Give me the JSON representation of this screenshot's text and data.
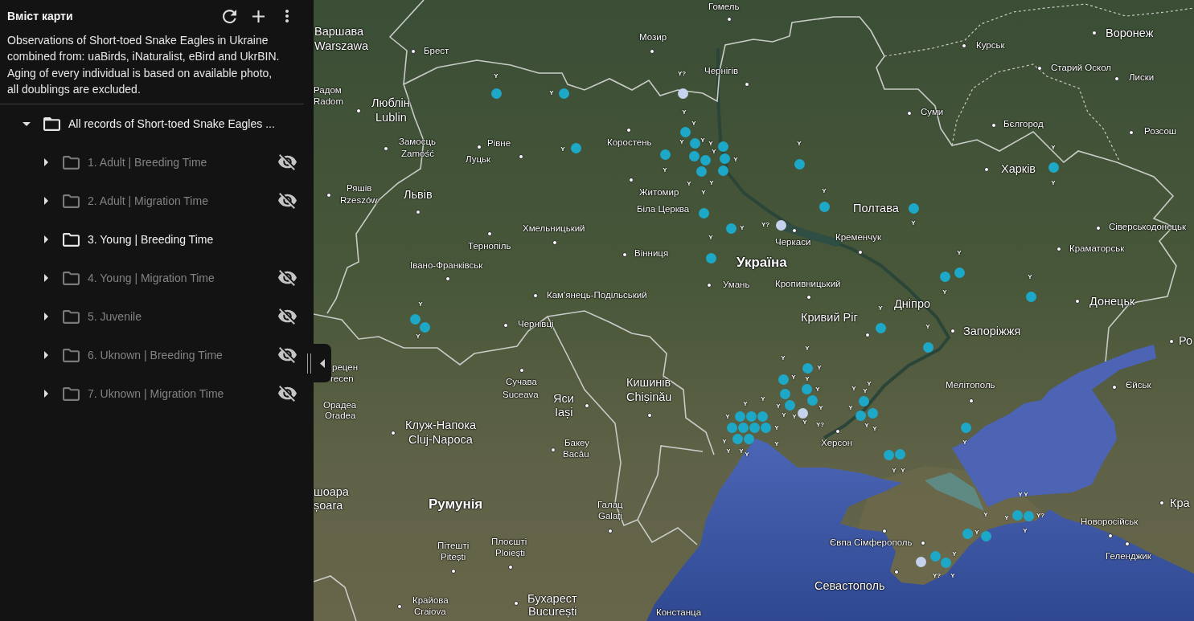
{
  "sidebar": {
    "title": "Вміст карти",
    "description": "Observations of Short-toed Snake Eagles in Ukraine combined from: uaBirds, iNaturalist, eBird and UkrBIN. Aging of every individual is based on available photo, all doublings are excluded.",
    "tree": {
      "label": "All records of Short-toed Snake Eagles ...",
      "expanded": true,
      "visible": true,
      "children": [
        {
          "label": "1. Adult | Breeding Time",
          "expanded": false,
          "visible": false
        },
        {
          "label": "2. Adult | Migration Time",
          "expanded": false,
          "visible": false
        },
        {
          "label": "3. Young | Breeding Time",
          "expanded": false,
          "visible": true
        },
        {
          "label": "4. Young | Migration Time",
          "expanded": false,
          "visible": false
        },
        {
          "label": "5. Juvenile",
          "expanded": false,
          "visible": false
        },
        {
          "label": "6. Uknown | Breeding Time",
          "expanded": false,
          "visible": false
        },
        {
          "label": "7. Uknown | Migration Time",
          "expanded": false,
          "visible": false
        }
      ]
    }
  },
  "map": {
    "place_labels": [
      {
        "text": "Гомель",
        "kind": "minor"
      },
      {
        "text": "Варшава",
        "kind": "major"
      },
      {
        "text": "Warszawa",
        "kind": "major"
      },
      {
        "text": "Мозир",
        "kind": "minor"
      },
      {
        "text": "Воронеж",
        "kind": "major"
      },
      {
        "text": "Брест",
        "kind": "minor"
      },
      {
        "text": "Курськ",
        "kind": "minor"
      },
      {
        "text": "Чернігів",
        "kind": "minor"
      },
      {
        "text": "Старий Оскол",
        "kind": "minor"
      },
      {
        "text": "Лиски",
        "kind": "minor"
      },
      {
        "text": "Радом",
        "kind": "minor"
      },
      {
        "text": "Radom",
        "kind": "minor"
      },
      {
        "text": "Люблін",
        "kind": "major"
      },
      {
        "text": "Lublin",
        "kind": "major"
      },
      {
        "text": "Суми",
        "kind": "minor"
      },
      {
        "text": "Бєлгород",
        "kind": "minor"
      },
      {
        "text": "Розсош",
        "kind": "minor"
      },
      {
        "text": "Замосць",
        "kind": "minor"
      },
      {
        "text": "Рівне",
        "kind": "minor"
      },
      {
        "text": "Коростень",
        "kind": "minor"
      },
      {
        "text": "Zamość",
        "kind": "minor"
      },
      {
        "text": "Луцьк",
        "kind": "minor"
      },
      {
        "text": "Харків",
        "kind": "major"
      },
      {
        "text": "Ряшів",
        "kind": "minor"
      },
      {
        "text": "Rzeszów",
        "kind": "minor"
      },
      {
        "text": "Львів",
        "kind": "major"
      },
      {
        "text": "Житомир",
        "kind": "minor"
      },
      {
        "text": "Біла Церква",
        "kind": "minor"
      },
      {
        "text": "Полтава",
        "kind": "major"
      },
      {
        "text": "Хмельницький",
        "kind": "minor"
      },
      {
        "text": "Сіверськодонецьк",
        "kind": "minor"
      },
      {
        "text": "Тернопіль",
        "kind": "minor"
      },
      {
        "text": "Черкаси",
        "kind": "minor"
      },
      {
        "text": "Кременчук",
        "kind": "minor"
      },
      {
        "text": "Вінниця",
        "kind": "minor"
      },
      {
        "text": "Краматорськ",
        "kind": "minor"
      },
      {
        "text": "Івано-Франківськ",
        "kind": "minor"
      },
      {
        "text": "Україна",
        "kind": "country"
      },
      {
        "text": "Умань",
        "kind": "minor"
      },
      {
        "text": "Кропивницький",
        "kind": "minor"
      },
      {
        "text": "Кам'янець-Подільський",
        "kind": "minor"
      },
      {
        "text": "Дніпро",
        "kind": "major"
      },
      {
        "text": "Донецьк",
        "kind": "major"
      },
      {
        "text": "Чернівці",
        "kind": "minor"
      },
      {
        "text": "Кривий Ріг",
        "kind": "major"
      },
      {
        "text": "Запоріжжя",
        "kind": "major"
      },
      {
        "text": "Ро",
        "kind": "major"
      },
      {
        "text": "рецен",
        "kind": "minor"
      },
      {
        "text": "recen",
        "kind": "minor"
      },
      {
        "text": "Сучава",
        "kind": "minor"
      },
      {
        "text": "Кишинів",
        "kind": "major"
      },
      {
        "text": "Мелітополь",
        "kind": "minor"
      },
      {
        "text": "Єйськ",
        "kind": "minor"
      },
      {
        "text": "Suceava",
        "kind": "minor"
      },
      {
        "text": "Орадеа",
        "kind": "minor"
      },
      {
        "text": "Яси",
        "kind": "major"
      },
      {
        "text": "Chișinău",
        "kind": "major"
      },
      {
        "text": "Oradea",
        "kind": "minor"
      },
      {
        "text": "Iași",
        "kind": "major"
      },
      {
        "text": "Клуж-Напока",
        "kind": "major"
      },
      {
        "text": "Cluj-Napoca",
        "kind": "major"
      },
      {
        "text": "Бакеу",
        "kind": "minor"
      },
      {
        "text": "Херсон",
        "kind": "minor"
      },
      {
        "text": "Bacău",
        "kind": "minor"
      },
      {
        "text": "шоара",
        "kind": "major"
      },
      {
        "text": "șoara",
        "kind": "major"
      },
      {
        "text": "Румунія",
        "kind": "country"
      },
      {
        "text": "Галац",
        "kind": "minor"
      },
      {
        "text": "Кра",
        "kind": "major"
      },
      {
        "text": "Galați",
        "kind": "minor"
      },
      {
        "text": "Новоросійськ",
        "kind": "minor"
      },
      {
        "text": "Пітешті",
        "kind": "minor"
      },
      {
        "text": "Плоєшті",
        "kind": "minor"
      },
      {
        "text": "Євпа",
        "kind": "minor"
      },
      {
        "text": "Сімферополь",
        "kind": "minor"
      },
      {
        "text": "Pitești",
        "kind": "minor"
      },
      {
        "text": "Ploiești",
        "kind": "minor"
      },
      {
        "text": "Геленджик",
        "kind": "minor"
      },
      {
        "text": "Севастополь",
        "kind": "major"
      },
      {
        "text": "Крайова",
        "kind": "minor"
      },
      {
        "text": "Бухарест",
        "kind": "major"
      },
      {
        "text": "Craiova",
        "kind": "minor"
      },
      {
        "text": "București",
        "kind": "major"
      },
      {
        "text": "Констанца",
        "kind": "minor"
      }
    ],
    "observation_markers": [
      {
        "color": "#1ea8c8"
      },
      {
        "color": "#1ea8c8"
      },
      {
        "color": "#c4d2ee"
      },
      {
        "color": "#1ea8c8"
      },
      {
        "color": "#1ea8c8"
      },
      {
        "color": "#1ea8c8"
      },
      {
        "color": "#1ea8c8"
      },
      {
        "color": "#1ea8c8"
      },
      {
        "color": "#1ea8c8"
      },
      {
        "color": "#1ea8c8"
      },
      {
        "color": "#1ea8c8"
      },
      {
        "color": "#1ea8c8"
      },
      {
        "color": "#1ea8c8"
      },
      {
        "color": "#1ea8c8"
      },
      {
        "color": "#1ea8c8"
      },
      {
        "color": "#1ea8c8"
      },
      {
        "color": "#1ea8c8"
      },
      {
        "color": "#1ea8c8"
      },
      {
        "color": "#1ea8c8"
      },
      {
        "color": "#c4d2ee"
      },
      {
        "color": "#1ea8c8"
      },
      {
        "color": "#1ea8c8"
      },
      {
        "color": "#1ea8c8"
      },
      {
        "color": "#1ea8c8"
      },
      {
        "color": "#1ea8c8"
      },
      {
        "color": "#1ea8c8"
      },
      {
        "color": "#1ea8c8"
      },
      {
        "color": "#1ea8c8"
      },
      {
        "color": "#1ea8c8"
      },
      {
        "color": "#1ea8c8"
      },
      {
        "color": "#1ea8c8"
      },
      {
        "color": "#1ea8c8"
      },
      {
        "color": "#1ea8c8"
      },
      {
        "color": "#1ea8c8"
      },
      {
        "color": "#1ea8c8"
      },
      {
        "color": "#1ea8c8"
      },
      {
        "color": "#1ea8c8"
      },
      {
        "color": "#1ea8c8"
      },
      {
        "color": "#c4d2ee"
      },
      {
        "color": "#1ea8c8"
      },
      {
        "color": "#1ea8c8"
      },
      {
        "color": "#1ea8c8"
      },
      {
        "color": "#1ea8c8"
      },
      {
        "color": "#1ea8c8"
      },
      {
        "color": "#1ea8c8"
      },
      {
        "color": "#1ea8c8"
      },
      {
        "color": "#1ea8c8"
      },
      {
        "color": "#1ea8c8"
      },
      {
        "color": "#1ea8c8"
      },
      {
        "color": "#1ea8c8"
      },
      {
        "color": "#1ea8c8"
      },
      {
        "color": "#1ea8c8"
      },
      {
        "color": "#1ea8c8"
      },
      {
        "color": "#1ea8c8"
      },
      {
        "color": "#c4d2ee"
      },
      {
        "color": "#1ea8c8"
      },
      {
        "color": "#1ea8c8"
      }
    ],
    "placemark_labels": [
      "Y",
      "Y?",
      "Y",
      "Y",
      "Y",
      "Y",
      "Y",
      "Y",
      "Y",
      "Y",
      "Y",
      "Y",
      "Y",
      "Y",
      "Y",
      "Y",
      "Y",
      "Y",
      "Y",
      "Y",
      "Y?",
      "Y",
      "Y",
      "Y",
      "Y",
      "Y",
      "Y",
      "Y",
      "Y",
      "Y",
      "Y",
      "Y",
      "Y",
      "Y",
      "Y",
      "Y",
      "Y",
      "Y",
      "Y",
      "Y",
      "Y",
      "Y",
      "Y",
      "Y",
      "Y",
      "Y",
      "Y",
      "Y",
      "Y",
      "Y?",
      "Y",
      "Y",
      "Y",
      "Y",
      "Y",
      "Y",
      "Y",
      "Y",
      "Y",
      "Y",
      "Y",
      "Y",
      "Y",
      "Y",
      "Y?",
      "Y",
      "Y",
      "Y",
      "Y?",
      "Y"
    ]
  }
}
